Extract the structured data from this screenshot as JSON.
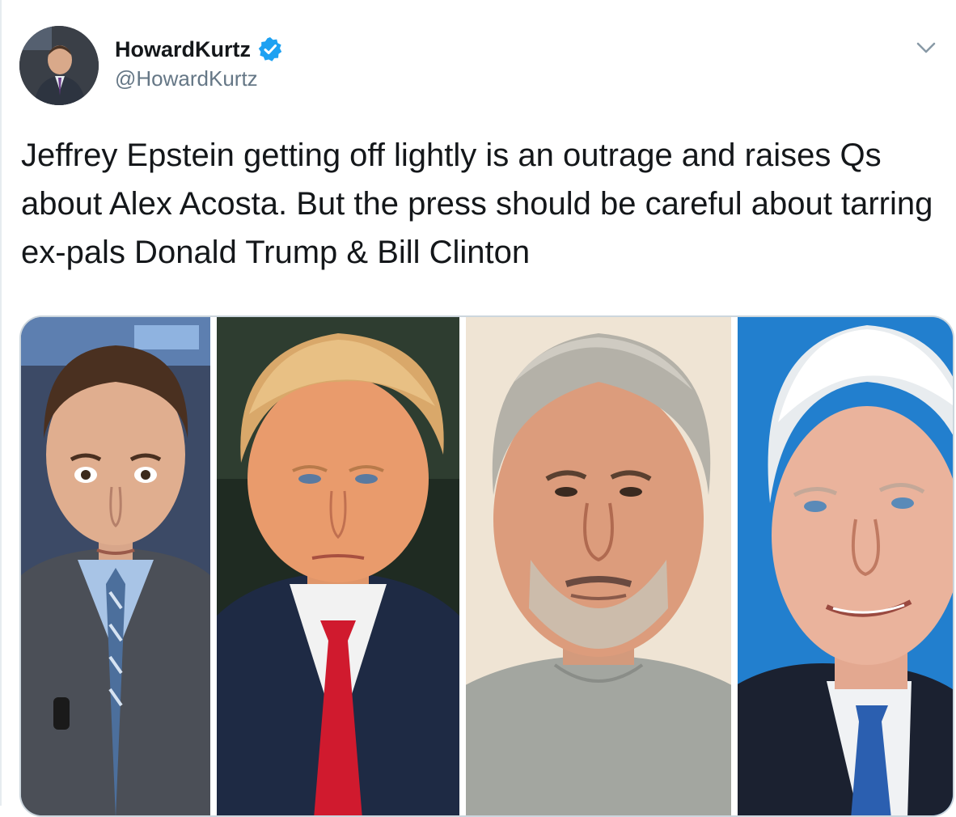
{
  "tweet": {
    "author": {
      "display_name": "HowardKurtz",
      "handle": "@HowardKurtz",
      "verified": true,
      "avatar_icon": "profile-avatar"
    },
    "text": "Jeffrey Epstein getting off lightly is an outrage and raises Qs about Alex Acosta. But the press should be careful about tarring ex-pals Donald Trump & Bill Clinton",
    "menu_icon": "chevron-down-icon",
    "media": {
      "type": "photo-collage",
      "panels": 4
    }
  },
  "colors": {
    "verified_blue": "#1da1f2",
    "handle_gray": "#657786",
    "text": "#14171a",
    "border": "#ccd6dd"
  }
}
